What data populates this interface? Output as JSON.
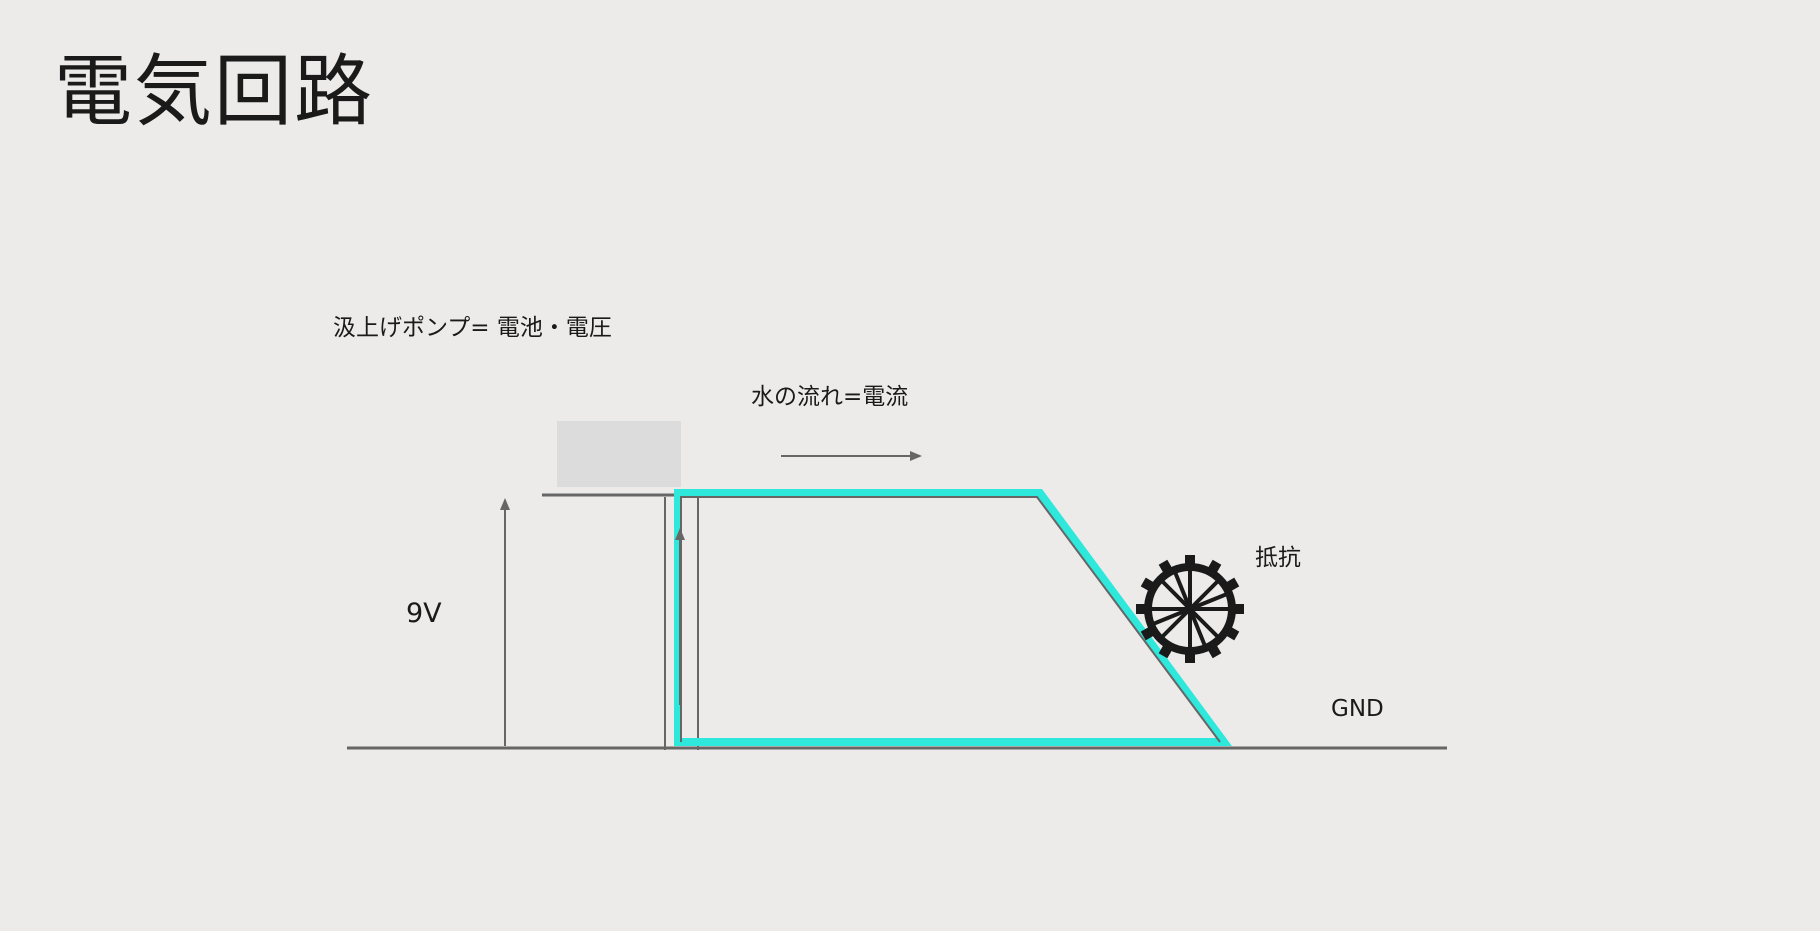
{
  "slide": {
    "title": "電気回路"
  },
  "labels": {
    "pump": "汲上げポンプ= 電池・電圧",
    "flow": "水の流れ=電流",
    "voltage": "9V",
    "resistance": "抵抗",
    "gnd": "GND"
  },
  "colors": {
    "background": "#ecebea",
    "current_path": "#2ee8dc",
    "line": "#666666",
    "wheel": "#1a1a1a",
    "pump_box": "#dcdcdc"
  },
  "icons": {
    "resistance": "water-wheel-icon",
    "flow_direction": "arrow-right-icon"
  }
}
